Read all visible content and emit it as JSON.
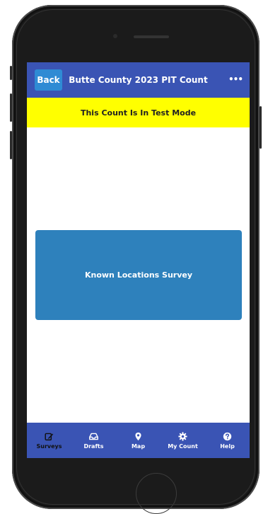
{
  "header": {
    "back_label": "Back",
    "title": "Butte County 2023 PIT Count",
    "more_icon": "ellipsis-icon",
    "more_label": "•••"
  },
  "banner": {
    "text": "This Count Is In Test Mode"
  },
  "main": {
    "survey_button": "Known Locations Survey"
  },
  "tabs": [
    {
      "label": "Surveys",
      "icon": "edit-icon",
      "active": true
    },
    {
      "label": "Drafts",
      "icon": "inbox-icon",
      "active": false
    },
    {
      "label": "Map",
      "icon": "map-pin-icon",
      "active": false
    },
    {
      "label": "My Count",
      "icon": "gear-icon",
      "active": false
    },
    {
      "label": "Help",
      "icon": "help-icon",
      "active": false
    }
  ],
  "colors": {
    "header_bg": "#3a54b4",
    "back_button": "#2f8bd4",
    "banner_bg": "#ffff00",
    "survey_button_bg": "#2e81bc",
    "active_tab_text": "#111111"
  }
}
